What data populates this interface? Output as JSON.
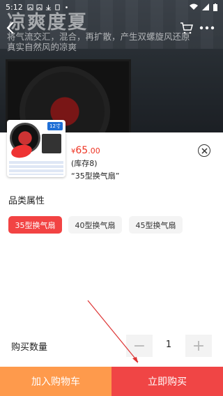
{
  "status_bar": {
    "time": "5:12"
  },
  "banner": {
    "title": "凉爽度夏",
    "subtitle": "将气流交汇，混合，再扩散，产生双螺旋风还原真实自然风的凉爽"
  },
  "nav": {
    "back_icon": "back-arrow-icon",
    "cart_icon": "cart-icon",
    "more_icon": "more-icon"
  },
  "product": {
    "thumbnail_badge": "12寸",
    "price_symbol": "¥",
    "price_integer": "65",
    "price_decimal": ".00",
    "stock": "(库存8)",
    "selected": "“35型换气扇”"
  },
  "attributes": {
    "title": "品类属性",
    "options": [
      {
        "label": "35型换气扇",
        "selected": true
      },
      {
        "label": "40型换气扇",
        "selected": false
      },
      {
        "label": "45型换气扇",
        "selected": false
      }
    ]
  },
  "quantity": {
    "label": "购买数量",
    "value": "1",
    "minus": "−",
    "plus": "+"
  },
  "actions": {
    "add_to_cart": "加入购物车",
    "buy_now": "立即购买"
  },
  "colors": {
    "price": "#ee3322",
    "accent": "#f24343",
    "cart_button": "#fe9a4c",
    "buy_button": "#f04545"
  }
}
